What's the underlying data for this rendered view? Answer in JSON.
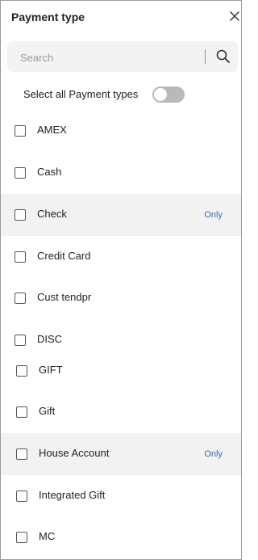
{
  "panel": {
    "title": "Payment type",
    "search_placeholder": "Search",
    "select_all_label": "Select all Payment types",
    "select_all_on": false
  },
  "items": [
    {
      "label": "AMEX",
      "checked": false
    },
    {
      "label": "Cash",
      "checked": false
    },
    {
      "label": "Check",
      "checked": false,
      "only": "Only"
    },
    {
      "label": "Credit Card",
      "checked": false
    },
    {
      "label": "Cust tendpr",
      "checked": false
    },
    {
      "label": "DISC",
      "checked": false
    },
    {
      "label": "GIFT",
      "checked": false
    },
    {
      "label": "Gift",
      "checked": false
    },
    {
      "label": "House Account",
      "checked": false,
      "only": "Only"
    },
    {
      "label": "Integrated Gift",
      "checked": false
    },
    {
      "label": "MC",
      "checked": false
    }
  ],
  "colors": {
    "only_link": "#2f6fb5",
    "row_highlight": "#f2f2f2",
    "toggle_off": "#b9b9b9"
  },
  "icons": {
    "close": "close-icon",
    "search": "search-icon"
  }
}
